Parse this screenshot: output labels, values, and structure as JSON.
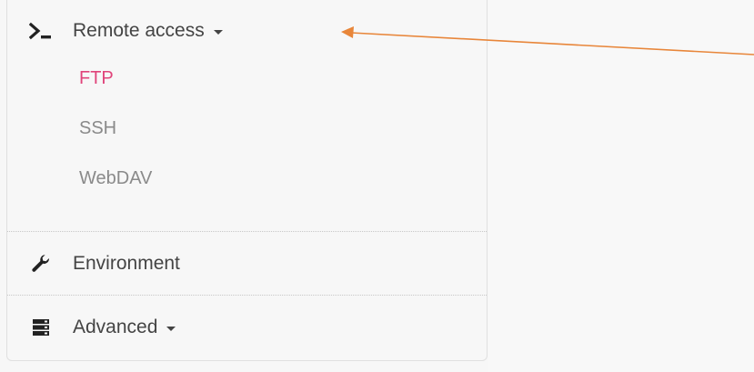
{
  "menu": {
    "remote_access": {
      "label": "Remote access",
      "icon": "terminal-icon",
      "children": [
        {
          "label": "FTP",
          "active": true
        },
        {
          "label": "SSH",
          "active": false
        },
        {
          "label": "WebDAV",
          "active": false
        }
      ]
    },
    "environment": {
      "label": "Environment",
      "icon": "wrench-icon"
    },
    "advanced": {
      "label": "Advanced",
      "icon": "server-icon"
    }
  },
  "colors": {
    "active_item": "#e0447a",
    "arrow": "#e8863a",
    "text": "#444444",
    "muted_text": "#8a8a8a"
  }
}
